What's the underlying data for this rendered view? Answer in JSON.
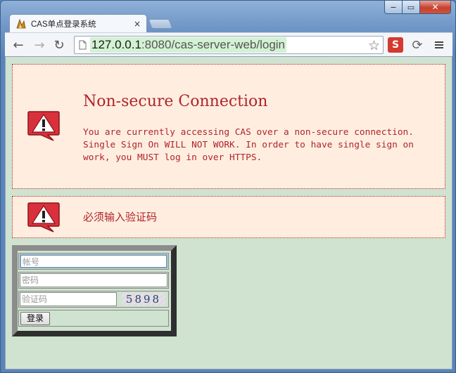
{
  "window": {
    "caption_buttons": {
      "minimize": "−",
      "maximize": "▭",
      "close": "✕"
    }
  },
  "tab": {
    "title": "CAS单点登录系统",
    "close": "×",
    "favicon": "cas-logo-icon"
  },
  "toolbar": {
    "back": "←",
    "forward": "→",
    "reload": "↻",
    "url_host": "127.0.0.1",
    "url_rest": ":8080/cas-server-web/login",
    "star": "☆",
    "ext1": "S",
    "ext2": "⟳"
  },
  "messages": {
    "nonsecure_title": "Non-secure Connection",
    "nonsecure_body": "You are currently accessing CAS over a non-secure connection. Single Sign On WILL NOT WORK. In order to have single sign on work, you MUST log in over HTTPS.",
    "captcha_error": "必须输入验证码"
  },
  "login": {
    "username_placeholder": "帐号",
    "password_placeholder": "密码",
    "captcha_placeholder": "验证码",
    "captcha_image_text": "5898",
    "submit_label": "登录"
  },
  "colors": {
    "error_text": "#b0242c",
    "message_bg": "#ffeedf",
    "page_bg": "#cfe3d0"
  }
}
